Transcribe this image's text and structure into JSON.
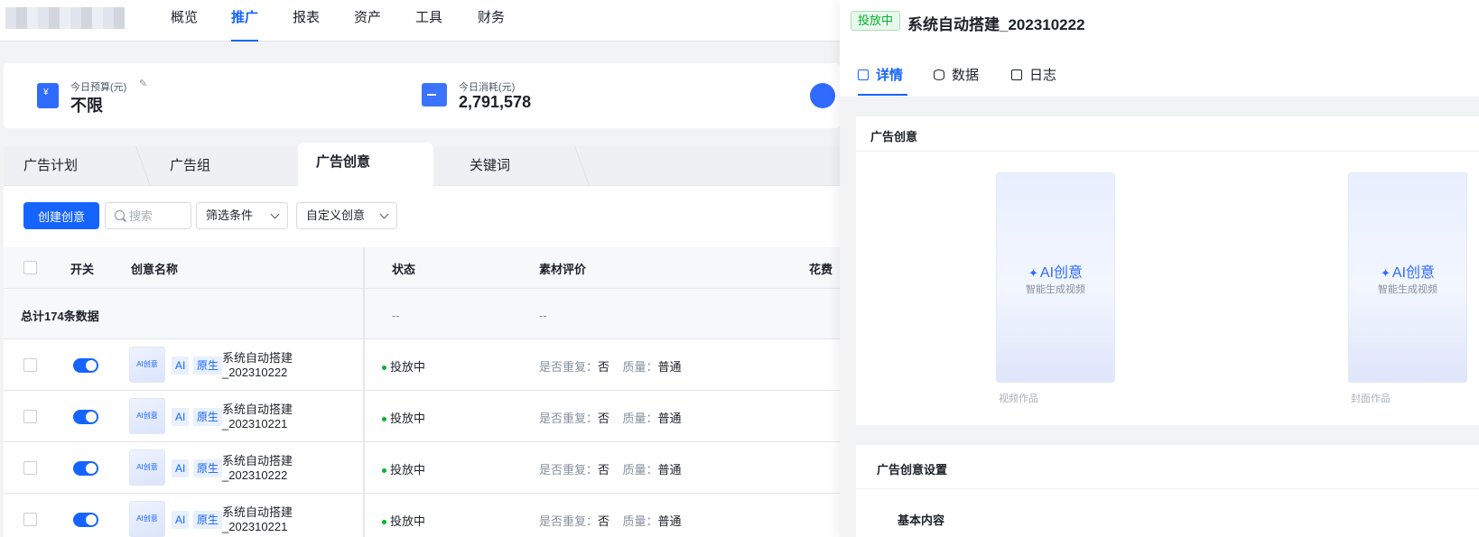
{
  "nav": {
    "items": [
      "概览",
      "推广",
      "报表",
      "资产",
      "工具",
      "财务"
    ],
    "active": "推广"
  },
  "stats": {
    "budget_label": "今日预算(元)",
    "budget_value": "不限",
    "spend_label": "今日消耗(元)",
    "spend_value": "2,791,578"
  },
  "tabs": [
    "广告计划",
    "广告组",
    "广告创意",
    "关键词"
  ],
  "toolbar": {
    "create_button": "创建创意",
    "search_placeholder": "搜索",
    "filter_label": "筛选条件",
    "custom_label": "自定义创意"
  },
  "table": {
    "headers": {
      "switch": "开关",
      "name": "创意名称",
      "status": "状态",
      "material": "素材评价",
      "cost": "花费"
    },
    "total_label": "总计174条数据",
    "total_status": "--",
    "total_material": "--",
    "rows": [
      {
        "thumb": "AI创意",
        "tag1": "AI",
        "tag2": "原生",
        "name": "系统自动搭建_202310222",
        "status": "投放中",
        "dup_label": "是否重复：",
        "dup_value": "否",
        "quality_label": "质量：",
        "quality_value": "普通"
      },
      {
        "thumb": "AI创意",
        "tag1": "AI",
        "tag2": "原生",
        "name": "系统自动搭建_202310221",
        "status": "投放中",
        "dup_label": "是否重复：",
        "dup_value": "否",
        "quality_label": "质量：",
        "quality_value": "普通"
      },
      {
        "thumb": "AI创意",
        "tag1": "AI",
        "tag2": "原生",
        "name": "系统自动搭建_202310222",
        "status": "投放中",
        "dup_label": "是否重复：",
        "dup_value": "否",
        "quality_label": "质量：",
        "quality_value": "普通"
      },
      {
        "thumb": "AI创意",
        "tag1": "AI",
        "tag2": "原生",
        "name": "系统自动搭建_202310221",
        "status": "投放中",
        "dup_label": "是否重复：",
        "dup_value": "否",
        "quality_label": "质量：",
        "quality_value": "普通"
      }
    ]
  },
  "panel": {
    "badge": "投放中",
    "title": "系统自动搭建_202310222",
    "tabs": [
      "详情",
      "数据",
      "日志"
    ],
    "creative_title": "广告创意",
    "previews": [
      {
        "ai": "AI创意",
        "sub": "智能生成视频",
        "caption": "视频作品"
      },
      {
        "ai": "AI创意",
        "sub": "智能生成视频",
        "caption": "封面作品"
      }
    ],
    "settings_title": "广告创意设置",
    "basic_title": "基本内容"
  },
  "colors": {
    "primary": "#1664ff",
    "success": "#00b42a"
  }
}
